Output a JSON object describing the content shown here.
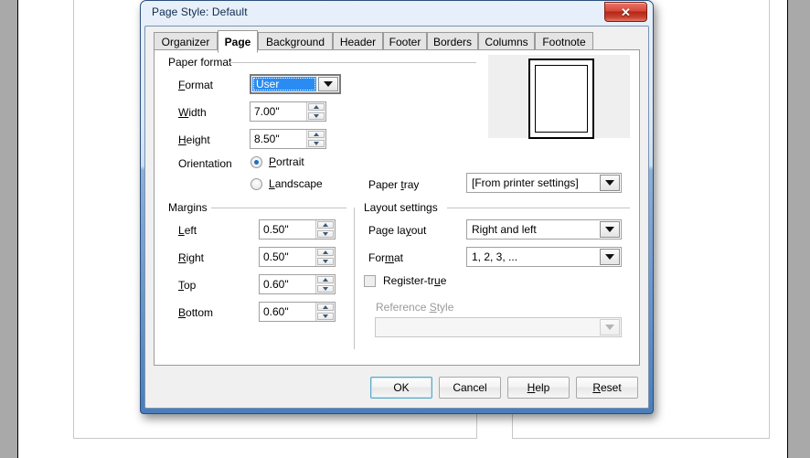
{
  "window": {
    "title": "Page Style: Default",
    "close_icon": "close-icon",
    "close_glyph": "✕"
  },
  "tabs": [
    {
      "label": "Organizer",
      "active": false
    },
    {
      "label": "Page",
      "active": true
    },
    {
      "label": "Background",
      "active": false
    },
    {
      "label": "Header",
      "active": false
    },
    {
      "label": "Footer",
      "active": false
    },
    {
      "label": "Borders",
      "active": false
    },
    {
      "label": "Columns",
      "active": false
    },
    {
      "label": "Footnote",
      "active": false
    }
  ],
  "paper_format": {
    "group_label": "Paper format",
    "format_label": "Format",
    "format_value": "User",
    "width_label": "Width",
    "width_value": "7.00\"",
    "height_label": "Height",
    "height_value": "8.50\"",
    "orientation_label": "Orientation",
    "portrait_label": "Portrait",
    "landscape_label": "Landscape",
    "orientation_selected": "Portrait"
  },
  "paper_tray": {
    "label": "Paper tray",
    "value": "[From printer settings]"
  },
  "margins": {
    "group_label": "Margins",
    "left_label": "Left",
    "left_value": "0.50\"",
    "right_label": "Right",
    "right_value": "0.50\"",
    "top_label": "Top",
    "top_value": "0.60\"",
    "bottom_label": "Bottom",
    "bottom_value": "0.60\""
  },
  "layout_settings": {
    "group_label": "Layout settings",
    "page_layout_label": "Page layout",
    "page_layout_value": "Right and left",
    "format_label": "Format",
    "format_value": "1, 2, 3, ...",
    "register_true_label": "Register-true",
    "register_true_checked": false,
    "reference_style_label": "Reference Style",
    "reference_style_value": ""
  },
  "buttons": {
    "ok": "OK",
    "cancel": "Cancel",
    "help": "Help",
    "reset": "Reset"
  },
  "colors": {
    "titlebar_top": "#e8f0fa",
    "titlebar_bottom": "#4a7ebb",
    "selection_blue": "#2a8cf2",
    "close_red": "#b32718",
    "dialog_face": "#f0f0f0",
    "canvas_gray": "#a9a9a9"
  }
}
